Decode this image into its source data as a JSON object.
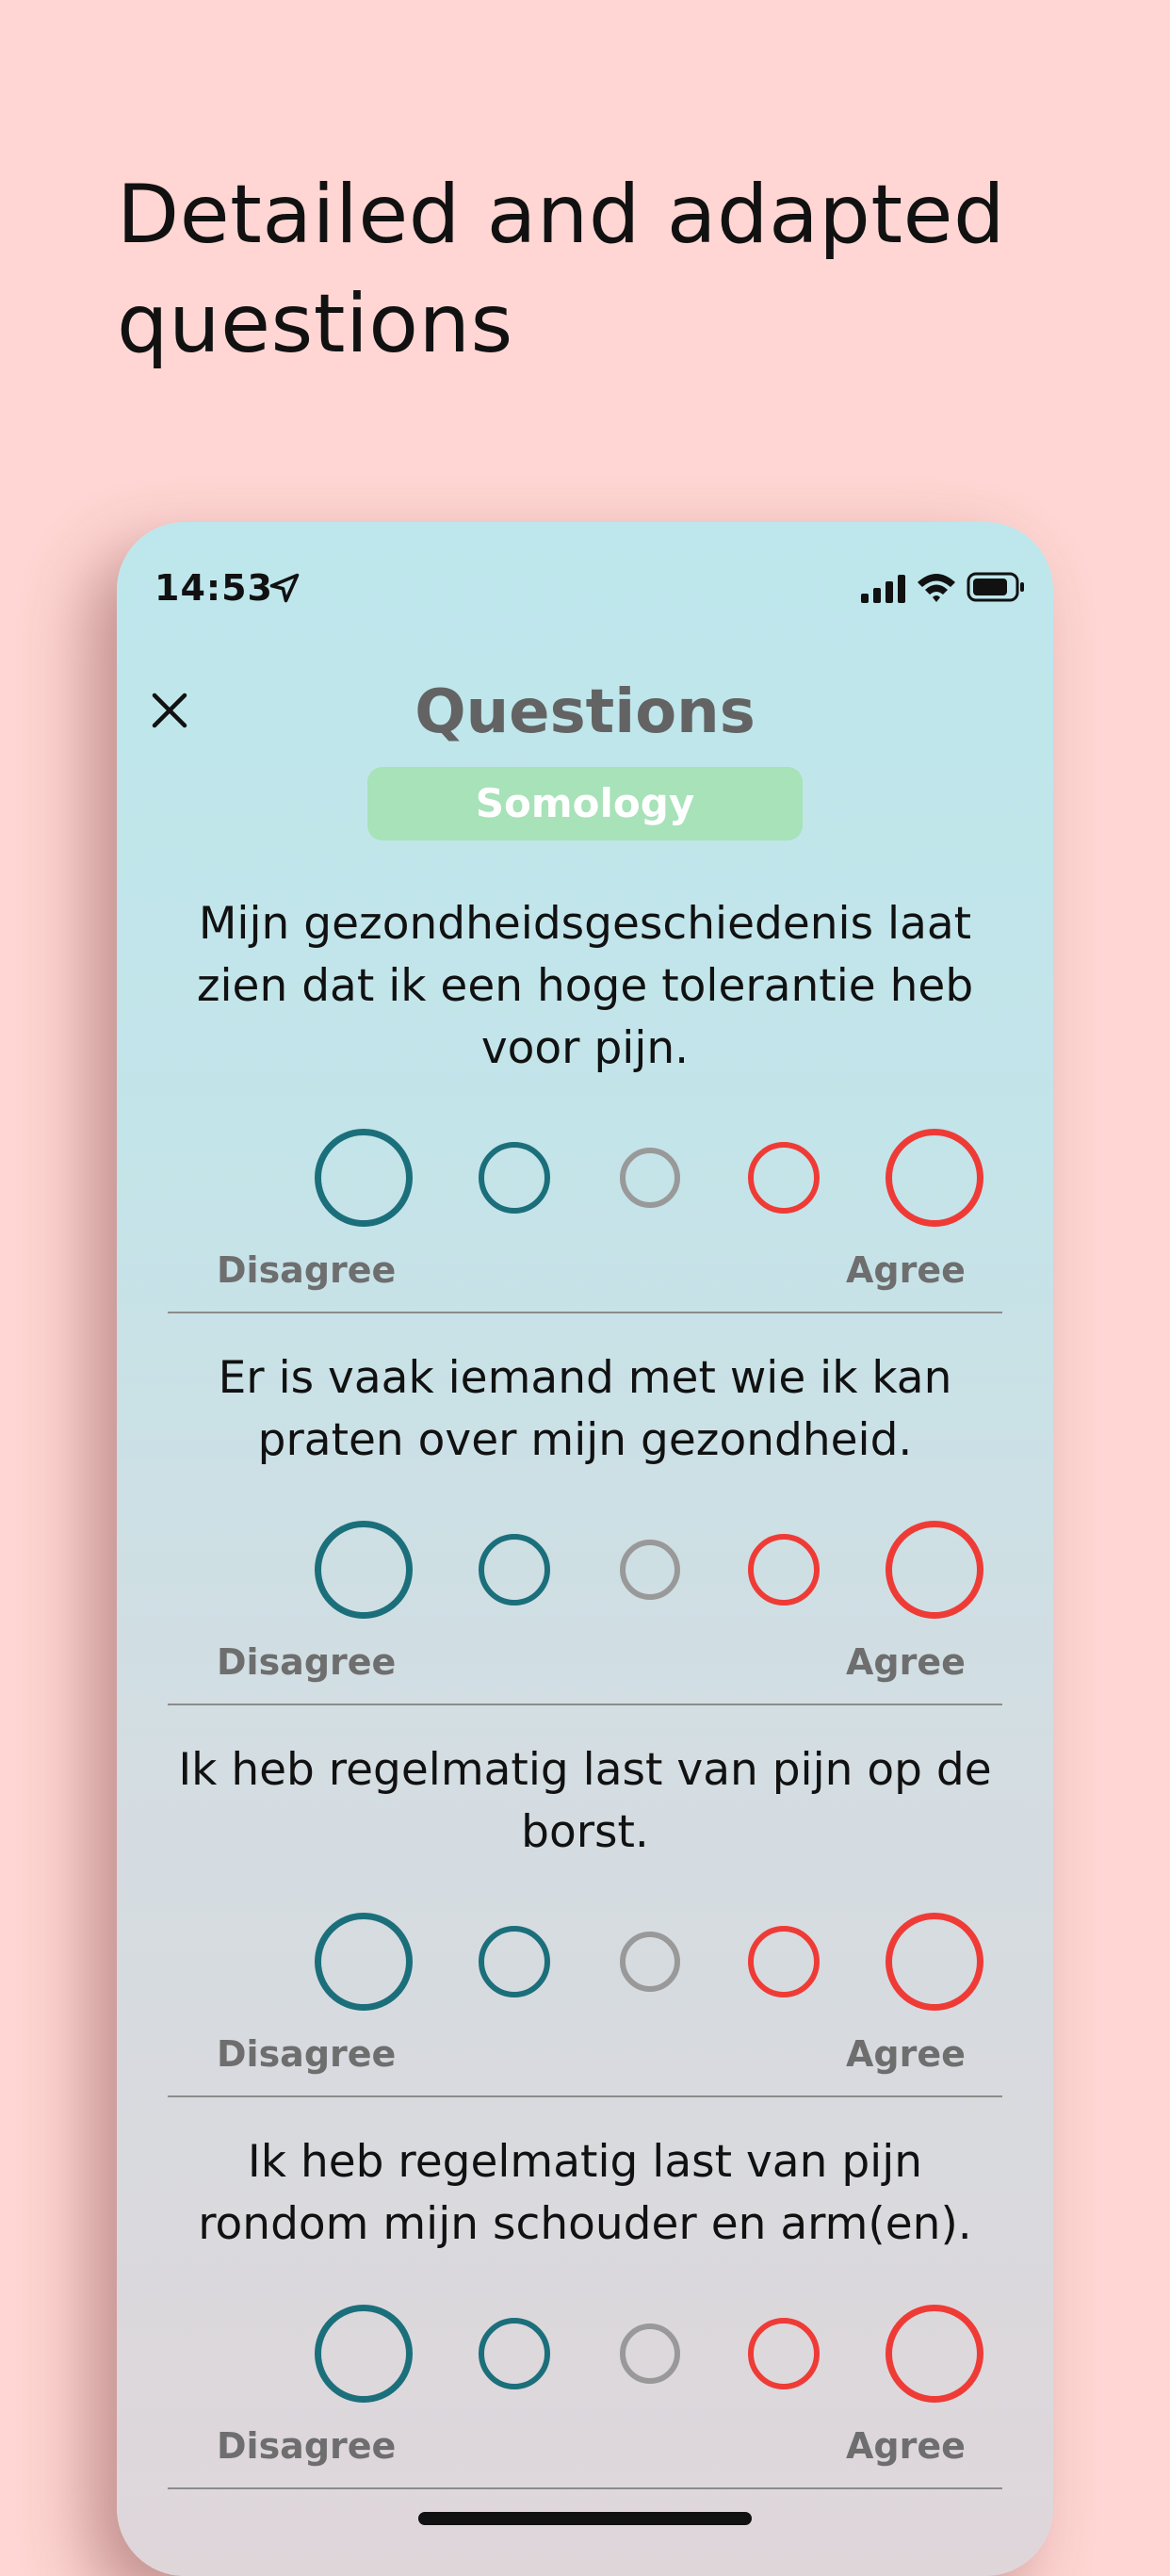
{
  "headline": "Detailed and adapted questions",
  "status_bar": {
    "time": "14:53",
    "icons": [
      "location-arrow-icon",
      "cellular-signal-icon",
      "wifi-icon",
      "battery-icon"
    ]
  },
  "header": {
    "close_icon": "close-icon",
    "title": "Questions",
    "category": "Somology"
  },
  "scale_labels": {
    "left": "Disagree",
    "right": "Agree"
  },
  "questions": [
    {
      "text": "Mijn gezondheidsgeschiedenis laat zien dat ik een hoge tolerantie heb voor pijn."
    },
    {
      "text": "Er is vaak iemand met wie ik kan praten over mijn gezondheid."
    },
    {
      "text": "Ik heb regelmatig last van pijn op de borst."
    },
    {
      "text": "Ik heb regelmatig last van pijn rondom mijn schouder en arm(en)."
    }
  ],
  "colors": {
    "background": "#ffd6d3",
    "disagree": "#1b6f7b",
    "neutral": "#999999",
    "agree": "#ef3b36",
    "badge": "#a7e2b8",
    "title": "#636363"
  }
}
